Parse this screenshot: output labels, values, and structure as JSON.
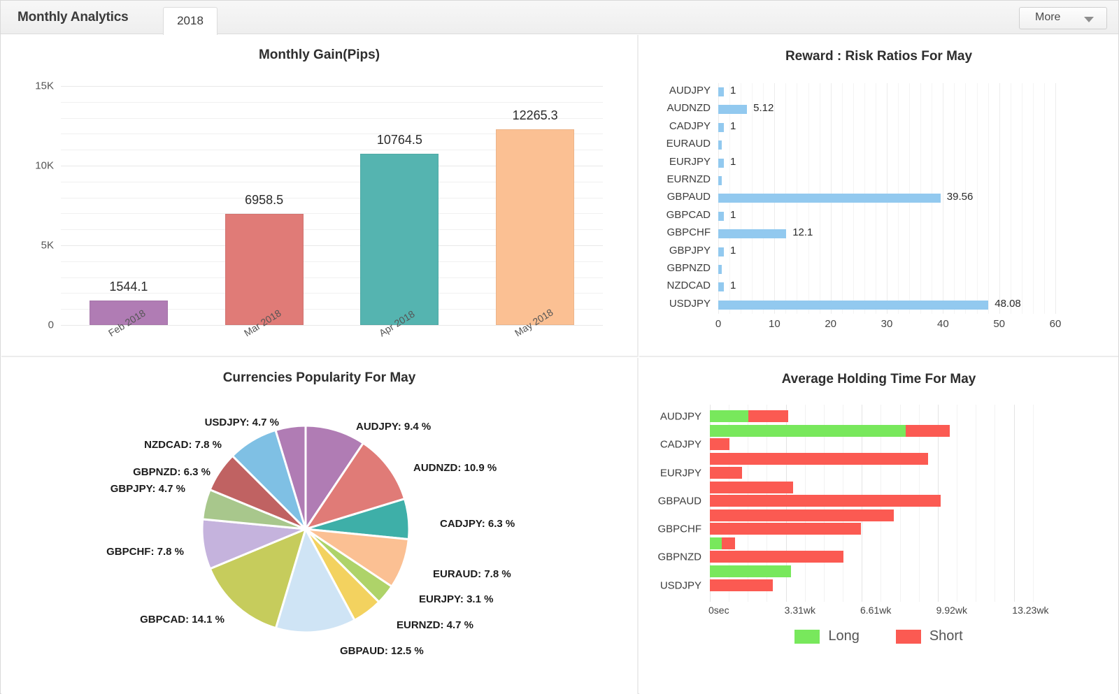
{
  "header": {
    "title": "Monthly Analytics",
    "tab_label": "2018",
    "more_label": "More",
    "caret_icon": "chevron-down-icon"
  },
  "chart_data": [
    {
      "type": "bar",
      "title": "Monthly Gain(Pips)",
      "xlabel": "",
      "ylabel": "",
      "ylim": [
        0,
        15000
      ],
      "yticks": [
        "0",
        "5K",
        "10K",
        "15K"
      ],
      "grid": true,
      "categories": [
        "Feb 2018",
        "Mar 2018",
        "Apr 2018",
        "May 2018"
      ],
      "values": [
        1544.1,
        6958.5,
        10764.5,
        12265.3
      ],
      "value_labels": [
        "1544.1",
        "6958.5",
        "10764.5",
        "12265.3"
      ],
      "colors": [
        "#b07cb4",
        "#e07b77",
        "#55b4b0",
        "#fbc093"
      ]
    },
    {
      "type": "bar",
      "orientation": "horizontal",
      "title": "Reward : Risk Ratios For May",
      "xlabel": "",
      "ylabel": "",
      "xlim": [
        0,
        60
      ],
      "xticks": [
        "0",
        "10",
        "20",
        "30",
        "40",
        "50",
        "60"
      ],
      "grid": true,
      "bar_color": "#92c9ef",
      "categories": [
        "AUDJPY",
        "AUDNZD",
        "CADJPY",
        "EURAUD",
        "EURJPY",
        "EURNZD",
        "GBPAUD",
        "GBPCAD",
        "GBPCHF",
        "GBPJPY",
        "GBPNZD",
        "NZDCAD",
        "USDJPY"
      ],
      "values": [
        1,
        5.12,
        1,
        0.55,
        1,
        0.55,
        39.56,
        1,
        12.1,
        1,
        0.55,
        1,
        48.08
      ],
      "value_labels": [
        "1",
        "5.12",
        "1",
        "",
        "1",
        "",
        "39.56",
        "1",
        "12.1",
        "1",
        "",
        "1",
        "48.08"
      ]
    },
    {
      "type": "pie",
      "title": "Currencies Popularity For May",
      "legend_position": "outside-labels",
      "categories": [
        "AUDJPY",
        "AUDNZD",
        "CADJPY",
        "EURAUD",
        "EURJPY",
        "EURNZD",
        "GBPAUD",
        "GBPCAD",
        "GBPCHF",
        "GBPJPY",
        "GBPNZD",
        "NZDCAD",
        "USDJPY"
      ],
      "values": [
        9.4,
        10.9,
        6.3,
        7.8,
        3.1,
        4.7,
        12.5,
        14.1,
        7.8,
        4.7,
        6.3,
        7.8,
        4.7
      ],
      "labels": [
        "AUDJPY: 9.4 %",
        "AUDNZD: 10.9 %",
        "CADJPY: 6.3 %",
        "EURAUD: 7.8 %",
        "EURJPY: 3.1 %",
        "EURNZD: 4.7 %",
        "GBPAUD: 12.5 %",
        "GBPCAD: 14.1 %",
        "GBPCHF: 7.8 %",
        "GBPJPY: 4.7 %",
        "GBPNZD: 6.3 %",
        "NZDCAD: 7.8 %",
        "USDJPY: 4.7 %"
      ],
      "colors": [
        "#b07cb4",
        "#e07b77",
        "#3eafa8",
        "#fbc093",
        "#aed369",
        "#f3d25f",
        "#cfe4f5",
        "#c6cc5c",
        "#c5b3dd",
        "#a8c78c",
        "#c06262",
        "#7fc0e4",
        "#b07cb4"
      ]
    },
    {
      "type": "bar",
      "orientation": "horizontal-stacked-grouped",
      "title": "Average Holding Time For May",
      "xlabel": "",
      "ylabel": "",
      "xlim": [
        0,
        14.5
      ],
      "xticks": [
        "0sec",
        "3.31wk",
        "6.61wk",
        "9.92wk",
        "13.23wk"
      ],
      "xtick_values": [
        0,
        3.31,
        6.61,
        9.92,
        13.23
      ],
      "grid": true,
      "legend": [
        {
          "name": "Long",
          "color": "#78e85c"
        },
        {
          "name": "Short",
          "color": "#fb5a52"
        }
      ],
      "categories": [
        "AUDJPY",
        "CADJPY",
        "EURJPY",
        "GBPAUD",
        "GBPCHF",
        "GBPNZD",
        "USDJPY"
      ],
      "rows": [
        {
          "category": "AUDJPY",
          "sub": 0,
          "long": 1.68,
          "short": 1.72
        },
        {
          "category": "AUDJPY",
          "sub": 1,
          "long": 8.52,
          "short": 1.92
        },
        {
          "category": "CADJPY",
          "sub": 0,
          "long": 0,
          "short": 0.85
        },
        {
          "category": "CADJPY",
          "sub": 1,
          "long": 0,
          "short": 9.5
        },
        {
          "category": "EURJPY",
          "sub": 0,
          "long": 0,
          "short": 1.4
        },
        {
          "category": "EURJPY",
          "sub": 1,
          "long": 0,
          "short": 3.63
        },
        {
          "category": "GBPAUD",
          "sub": 0,
          "long": 0,
          "short": 10.05
        },
        {
          "category": "GBPAUD",
          "sub": 1,
          "long": 0,
          "short": 8.0
        },
        {
          "category": "GBPCHF",
          "sub": 0,
          "long": 0,
          "short": 6.58
        },
        {
          "category": "GBPCHF",
          "sub": 1,
          "long": 0.52,
          "short": 0.58
        },
        {
          "category": "GBPNZD",
          "sub": 0,
          "long": 0,
          "short": 5.82
        },
        {
          "category": "GBPNZD",
          "sub": 1,
          "long": 3.53,
          "short": 0
        },
        {
          "category": "USDJPY",
          "sub": 0,
          "long": 0,
          "short": 2.75
        }
      ]
    }
  ]
}
